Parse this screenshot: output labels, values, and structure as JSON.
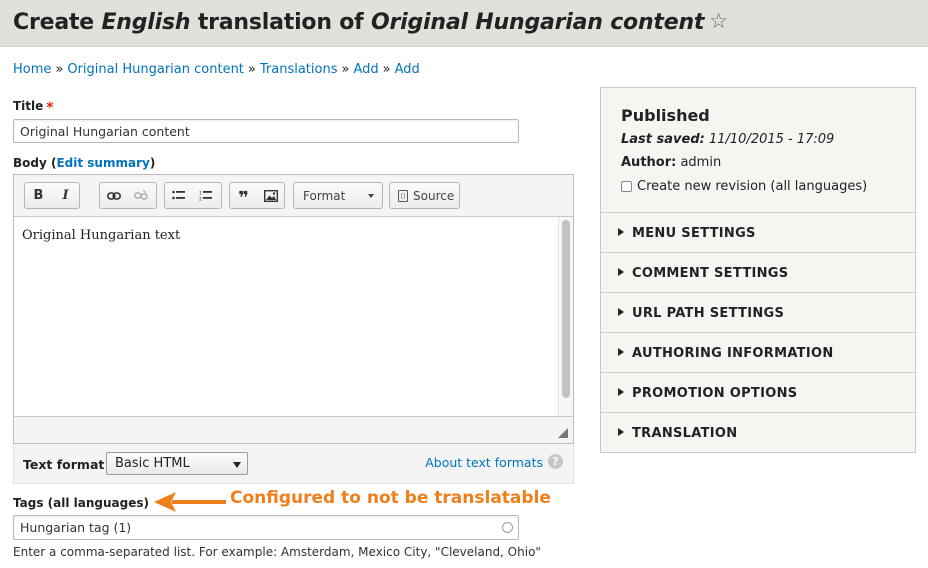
{
  "header": {
    "title_prefix": "Create ",
    "title_lang": "English",
    "title_mid": " translation of ",
    "title_node": "Original Hungarian content",
    "star_icon": "star-outline-icon"
  },
  "breadcrumb": [
    "Home",
    "Original Hungarian content",
    "Translations",
    "Add",
    "Add"
  ],
  "breadcrumb_sep": "»",
  "title_field": {
    "label": "Title",
    "required_mark": "*",
    "value": "Original Hungarian content"
  },
  "body_field": {
    "label_prefix": "Body (",
    "edit_summary": "Edit summary",
    "label_suffix": ")",
    "toolbar": {
      "bold": "B",
      "italic": "I",
      "format_label": "Format",
      "source_label": "Source"
    },
    "content": "Original Hungarian text"
  },
  "text_format": {
    "label": "Text format",
    "selected": "Basic HTML",
    "about_link": "About text formats",
    "help_icon": "?"
  },
  "tags_field": {
    "label": "Tags (all languages)",
    "value": "Hungarian tag (1)",
    "help": "Enter a comma-separated list. For example: Amsterdam, Mexico City, \"Cleveland, Ohio\""
  },
  "annotation": {
    "text": "Configured to not be translatable",
    "color": "#ef7f1a"
  },
  "sidebar": {
    "status": "Published",
    "last_saved_label": "Last saved:",
    "last_saved_value": " 11/10/2015 - 17:09",
    "author_label": "Author:",
    "author_value": " admin",
    "revision_label": "Create new revision (all languages)",
    "sections": [
      "MENU SETTINGS",
      "COMMENT SETTINGS",
      "URL PATH SETTINGS",
      "AUTHORING INFORMATION",
      "PROMOTION OPTIONS",
      "TRANSLATION"
    ]
  },
  "colors": {
    "link": "#0074bd",
    "required": "#e62600",
    "header_bg": "#e1e1db"
  }
}
